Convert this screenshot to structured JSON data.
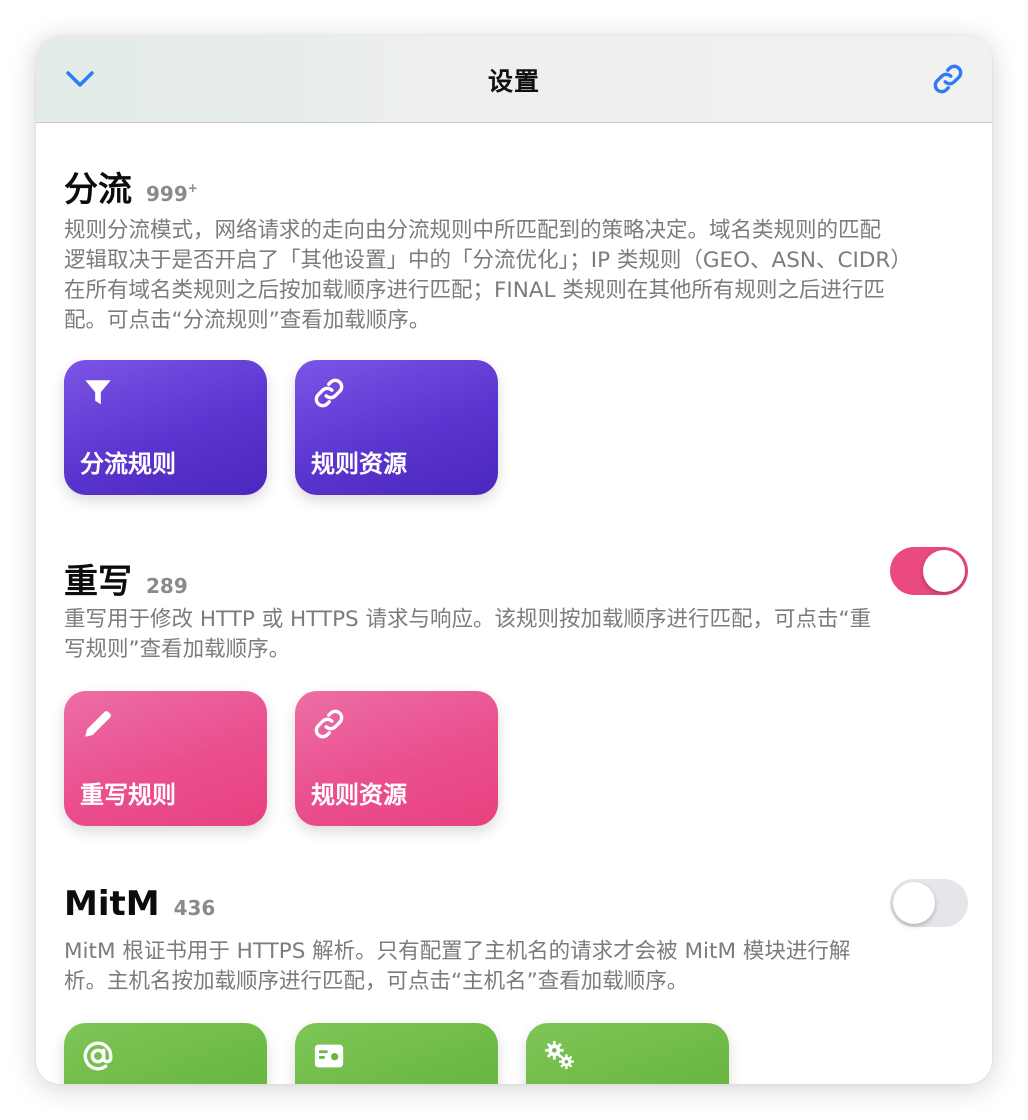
{
  "header": {
    "title": "设置",
    "back_icon": "chevron-down-icon",
    "link_icon": "link-icon",
    "accent_color": "#2f7bf5"
  },
  "sections": [
    {
      "title": "分流",
      "count": "999",
      "count_suffix": "+",
      "description_lines": [
        "规则分流模式，网络请求的走向由分流规则中所匹配到的策略决定。域名类规则的匹配",
        "逻辑取决于是否开启了「其他设置」中的「分流优化」；IP 类规则（GEO、ASN、CIDR）",
        "在所有域名类规则之后按加载顺序进行匹配；FINAL 类规则在其他所有规则之后进行匹",
        "配。可点击“分流规则”查看加载顺序。"
      ],
      "cards": [
        {
          "label": "分流规则",
          "icon": "filter-icon"
        },
        {
          "label": "规则资源",
          "icon": "link-icon"
        }
      ],
      "color": "#5a35cf"
    },
    {
      "title": "重写",
      "count": "289",
      "toggle_on": true,
      "description_lines": [
        "重写用于修改 HTTP 或 HTTPS 请求与响应。该规则按加载顺序进行匹配，可点击“重",
        "写规则”查看加载顺序。"
      ],
      "cards": [
        {
          "label": "重写规则",
          "icon": "pencil-icon"
        },
        {
          "label": "规则资源",
          "icon": "link-icon"
        }
      ],
      "color": "#ea4f8e"
    },
    {
      "title": "MitM",
      "count": "436",
      "toggle_on": false,
      "description_lines": [
        "MitM 根证书用于 HTTPS 解析。只有配置了主机名的请求才会被 MitM 模块进行解",
        "析。主机名按加载顺序进行匹配，可点击“主机名”查看加载顺序。"
      ],
      "cards": [
        {
          "icon": "at-sign-icon"
        },
        {
          "icon": "certificate-card-icon"
        },
        {
          "icon": "gears-icon"
        }
      ],
      "color": "#6ab742"
    }
  ]
}
